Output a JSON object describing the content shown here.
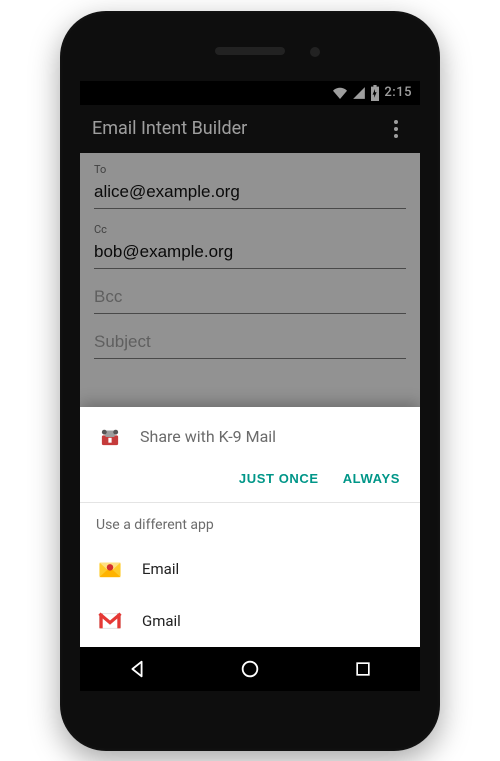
{
  "status": {
    "time": "2:15"
  },
  "appbar": {
    "title": "Email Intent Builder"
  },
  "form": {
    "to": {
      "label": "To",
      "value": "alice@example.org"
    },
    "cc": {
      "label": "Cc",
      "value": "bob@example.org"
    },
    "bcc": {
      "label": "Bcc",
      "value": ""
    },
    "subject": {
      "label": "Subject",
      "value": ""
    }
  },
  "resolver": {
    "primary_app_icon": "k9-mail-icon",
    "title": "Share with K-9 Mail",
    "just_once": "JUST ONCE",
    "always": "ALWAYS",
    "alt_title": "Use a different app",
    "apps": [
      {
        "icon": "email-icon",
        "label": "Email"
      },
      {
        "icon": "gmail-icon",
        "label": "Gmail"
      }
    ]
  }
}
